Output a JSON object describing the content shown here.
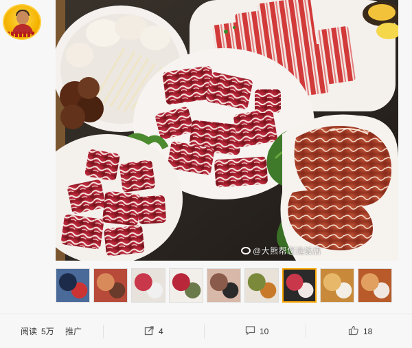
{
  "photo": {
    "watermark_text": "@大熊帮您选饭店"
  },
  "thumbnails": [
    {
      "name": "thumb-1",
      "colors": [
        "#4a6a9a",
        "#1d2b4a",
        "#c33"
      ]
    },
    {
      "name": "thumb-2",
      "colors": [
        "#b84a3a",
        "#d98a5a",
        "#6a3a2a"
      ]
    },
    {
      "name": "thumb-3",
      "colors": [
        "#e8e2dc",
        "#c9384a",
        "#f0f0f0"
      ]
    },
    {
      "name": "thumb-4",
      "colors": [
        "#f2eeea",
        "#b8283a",
        "#6a7a4a"
      ]
    },
    {
      "name": "thumb-5",
      "colors": [
        "#d8b8a8",
        "#8a5a4a",
        "#2a2a2a"
      ]
    },
    {
      "name": "thumb-6",
      "colors": [
        "#e8e2d8",
        "#7a8a3a",
        "#c87a2a"
      ]
    },
    {
      "name": "thumb-7",
      "colors": [
        "#2a2a2a",
        "#c9384a",
        "#f0e8e4"
      ],
      "active": true
    },
    {
      "name": "thumb-8",
      "colors": [
        "#c88a3a",
        "#e8b86a",
        "#f3eee6"
      ]
    },
    {
      "name": "thumb-9",
      "colors": [
        "#b85a2a",
        "#e2a060",
        "#f0e8e0"
      ]
    }
  ],
  "actions": {
    "read_label": "阅读",
    "read_count": "5万",
    "promote_label": "推广",
    "share_count": "4",
    "comment_count": "10",
    "like_count": "18"
  },
  "colors": {
    "active_thumb_border": "#f7a400",
    "icon_gray": "#666666"
  }
}
